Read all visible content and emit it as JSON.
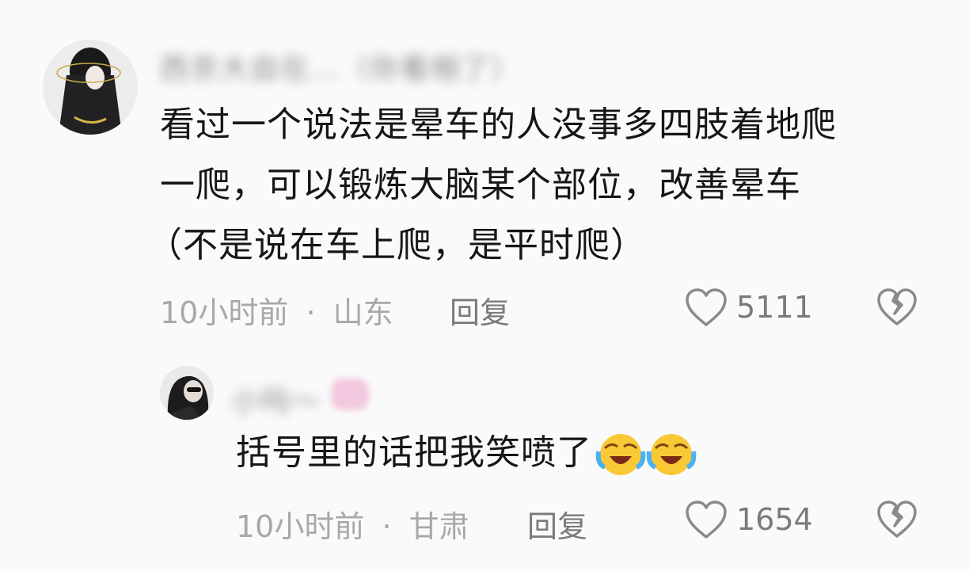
{
  "comments": [
    {
      "username": "西京大自在…（你看相了）",
      "text_lines": [
        "看过一个说法是晕车的人没事多四肢着地爬",
        "一爬，可以锻炼大脑某个部位，改善晕车",
        "（不是说在车上爬，是平时爬）"
      ],
      "time": "10小时前",
      "dot": "·",
      "location": "山东",
      "reply_label": "回复",
      "like_count": "5111"
    },
    {
      "username": "小吗～",
      "text": "括号里的话把我笑喷了",
      "emoji_count": 2,
      "time": "10小时前",
      "dot": "·",
      "location": "甘肃",
      "reply_label": "回复",
      "like_count": "1654"
    }
  ],
  "colors": {
    "text": "#161616",
    "meta": "#a8a8a8",
    "secondary": "#7a7a7a",
    "background": "#fafafa"
  }
}
